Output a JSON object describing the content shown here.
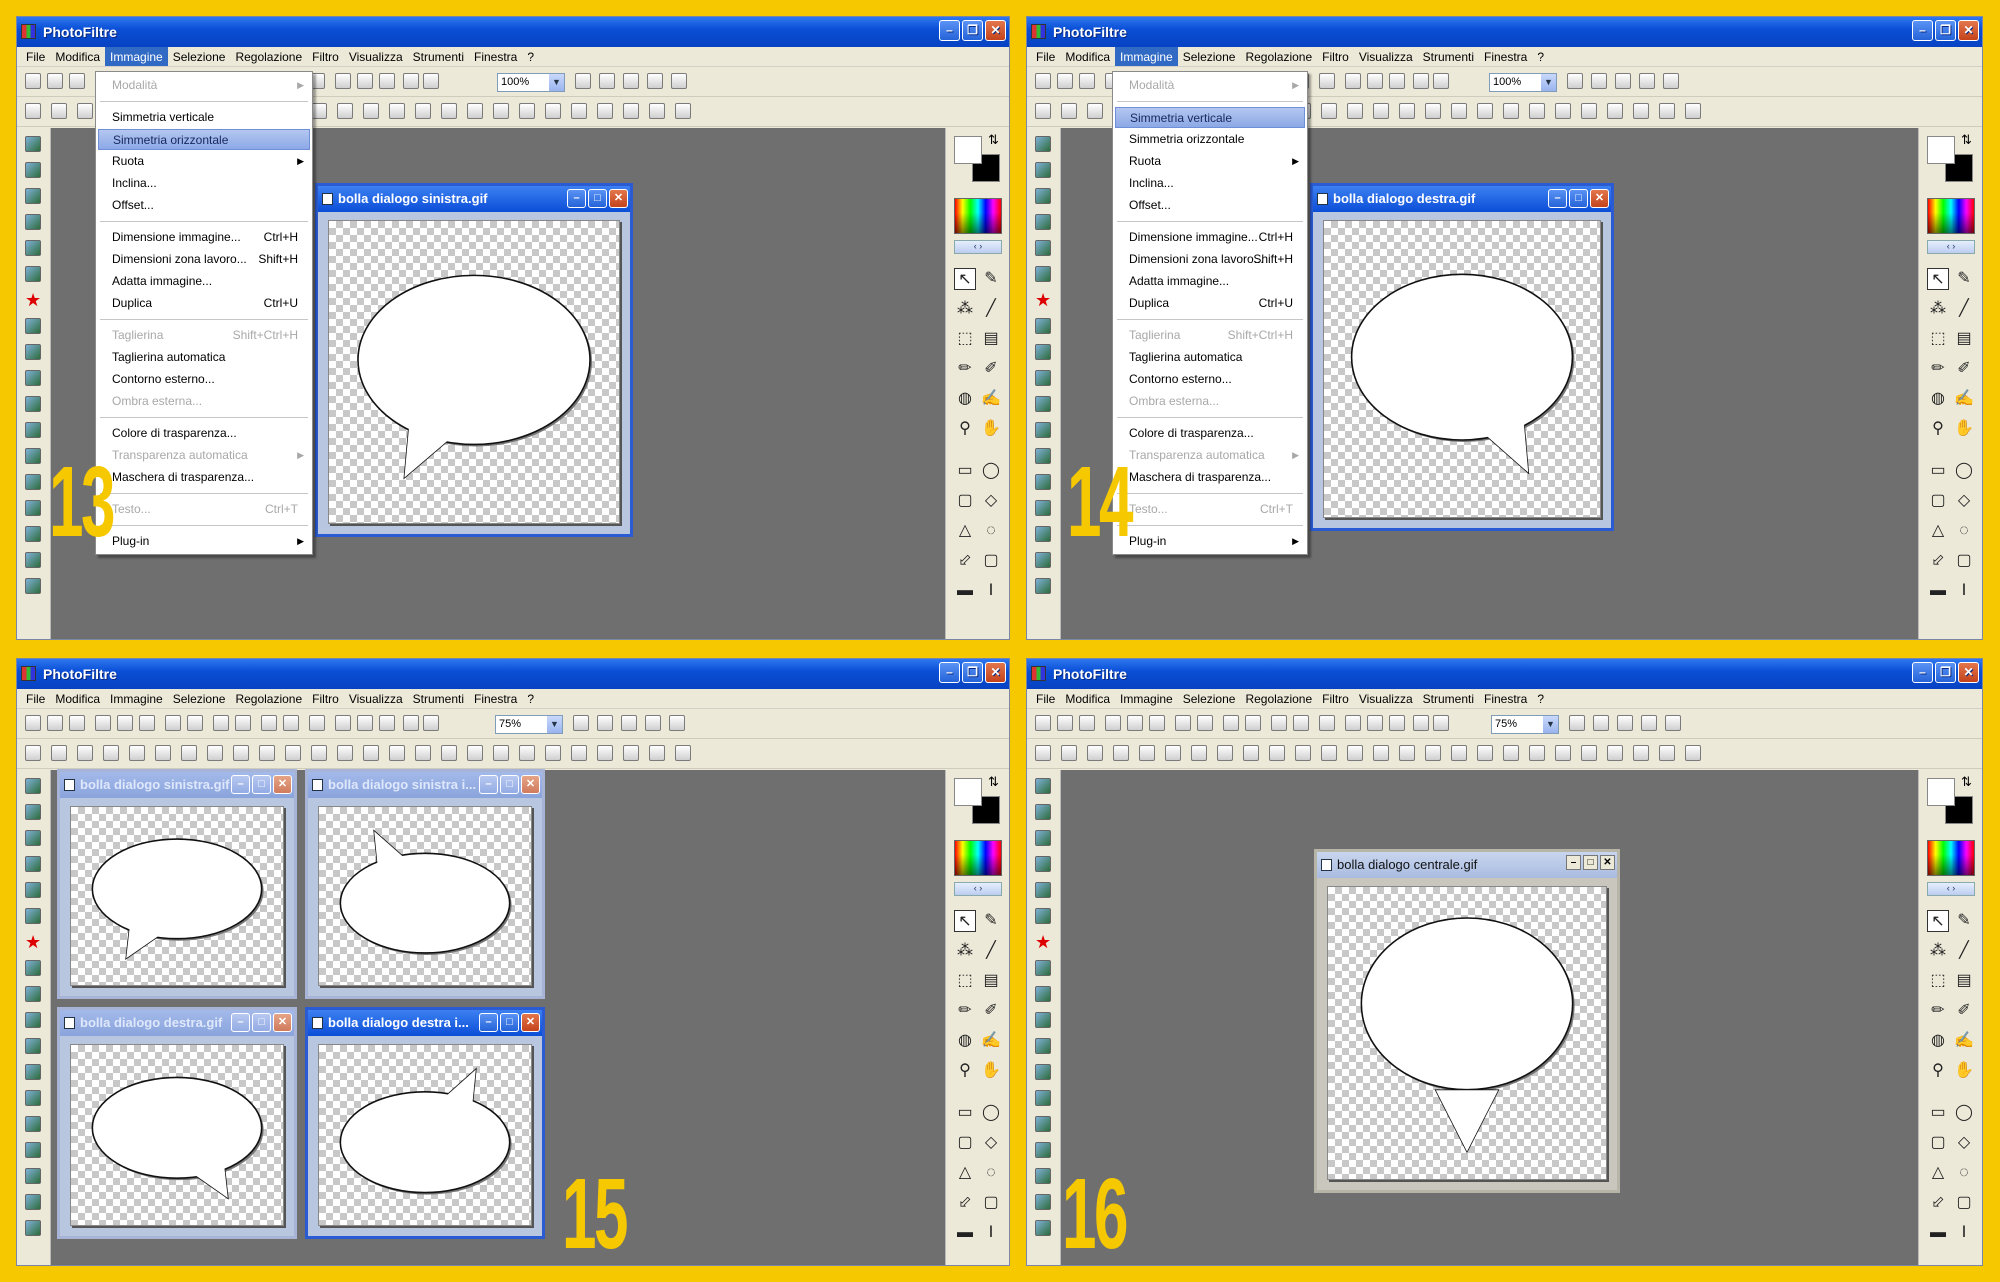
{
  "app_title": "PhotoFiltre",
  "menu": [
    "File",
    "Modifica",
    "Immagine",
    "Selezione",
    "Regolazione",
    "Filtro",
    "Visualizza",
    "Strumenti",
    "Finestra",
    "?"
  ],
  "immagine_menu": [
    {
      "label": "Modalità",
      "disabled": true,
      "sub": true
    },
    {
      "sep": true
    },
    {
      "label": "Simmetria verticale"
    },
    {
      "label": "Simmetria orizzontale"
    },
    {
      "label": "Ruota",
      "sub": true
    },
    {
      "label": "Inclina..."
    },
    {
      "label": "Offset..."
    },
    {
      "sep": true
    },
    {
      "label": "Dimensione immagine...",
      "shortcut": "Ctrl+H"
    },
    {
      "label": "Dimensioni zona lavoro...",
      "shortcut": "Shift+H"
    },
    {
      "label": "Adatta immagine..."
    },
    {
      "label": "Duplica",
      "shortcut": "Ctrl+U"
    },
    {
      "sep": true
    },
    {
      "label": "Taglierina",
      "shortcut": "Shift+Ctrl+H",
      "disabled": true
    },
    {
      "label": "Taglierina automatica"
    },
    {
      "label": "Contorno esterno..."
    },
    {
      "label": "Ombra esterna...",
      "disabled": true
    },
    {
      "sep": true
    },
    {
      "label": "Colore di trasparenza..."
    },
    {
      "label": "Transparenza automatica",
      "disabled": true,
      "sub": true
    },
    {
      "label": "Maschera di trasparenza..."
    },
    {
      "sep": true
    },
    {
      "label": "Testo...",
      "shortcut": "Ctrl+T",
      "disabled": true
    },
    {
      "sep": true
    },
    {
      "label": "Plug-in",
      "sub": true
    }
  ],
  "panels": [
    {
      "step": "13",
      "zoom": "100%",
      "menu_open": true,
      "highlighted": "Simmetria orizzontale",
      "docs": [
        {
          "title": "bolla dialogo sinistra.gif",
          "bubble": "left",
          "active": true
        }
      ]
    },
    {
      "step": "14",
      "zoom": "100%",
      "menu_open": true,
      "highlighted": "Simmetria verticale",
      "docs": [
        {
          "title": "bolla dialogo destra.gif",
          "bubble": "right",
          "active": true
        }
      ]
    },
    {
      "step": "15",
      "zoom": "75%",
      "menu_open": false,
      "docs": [
        {
          "title": "bolla dialogo sinistra.gif",
          "bubble": "left",
          "active": false
        },
        {
          "title": "bolla dialogo sinistra i...",
          "bubble": "left-top",
          "active": false
        },
        {
          "title": "bolla dialogo destra.gif",
          "bubble": "right",
          "active": false
        },
        {
          "title": "bolla dialogo destra i...",
          "bubble": "right-top",
          "active": true
        }
      ]
    },
    {
      "step": "16",
      "zoom": "75%",
      "menu_open": false,
      "docs": [
        {
          "title": "bolla dialogo centrale.gif",
          "bubble": "center",
          "active": true
        }
      ]
    }
  ]
}
